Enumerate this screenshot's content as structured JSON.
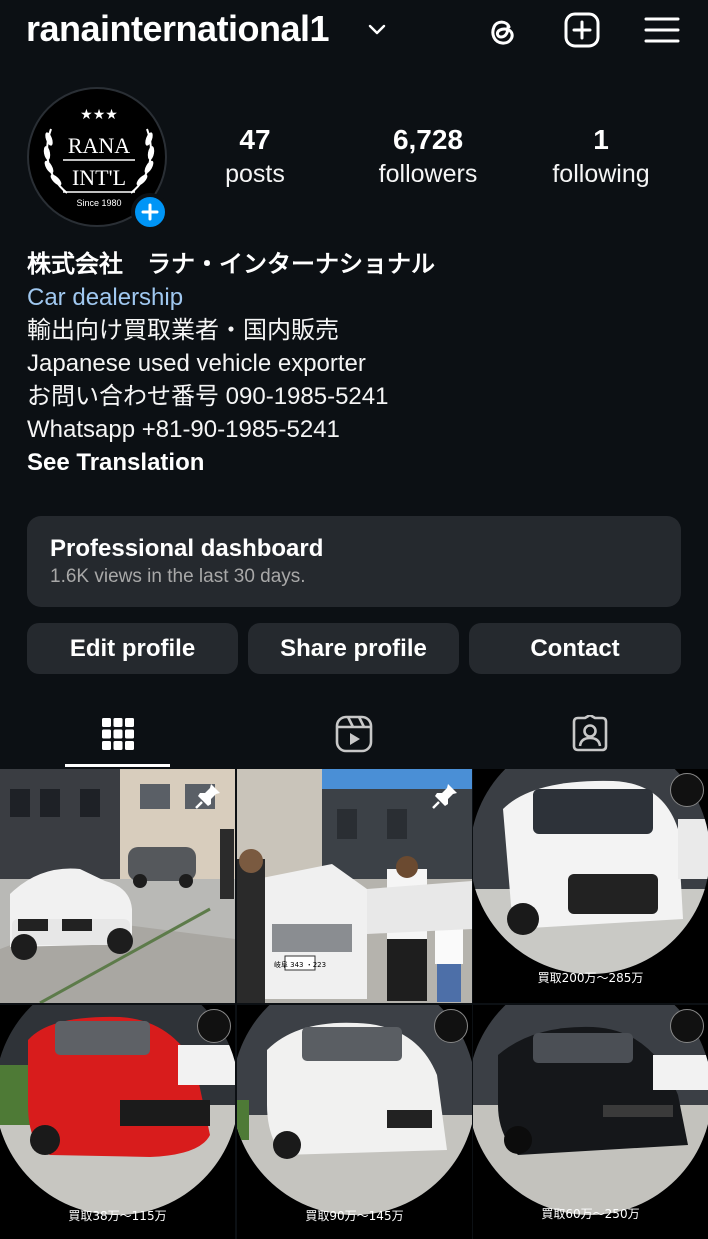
{
  "header": {
    "username": "ranainternational1",
    "icons": [
      "threads-icon",
      "create-post-icon",
      "menu-icon"
    ]
  },
  "avatar": {
    "logo_line1": "RANA",
    "logo_line2": "INT'L",
    "logo_since": "Since 1980"
  },
  "stats": {
    "posts_count": "47",
    "posts_label": "posts",
    "followers_count": "6,728",
    "followers_label": "followers",
    "following_count": "1",
    "following_label": "following"
  },
  "bio": {
    "name": "株式会社　ラナ・インターナショナル",
    "category": "Car dealership",
    "line1": "輸出向け買取業者・国内販売",
    "line2": "Japanese used vehicle exporter",
    "line3": "お問い合わせ番号 090-1985-5241",
    "line4": "Whatsapp +81-90-1985-5241",
    "see_translation": "See Translation"
  },
  "dashboard": {
    "title": "Professional dashboard",
    "subtitle": "1.6K views in the last 30 days."
  },
  "buttons": {
    "edit": "Edit profile",
    "share": "Share profile",
    "contact": "Contact"
  },
  "tabs": [
    "posts-grid-icon",
    "reels-icon",
    "tagged-icon"
  ],
  "grid": {
    "posts": [
      {
        "price": "",
        "pinned": true
      },
      {
        "price": "",
        "pinned": true,
        "plate": "岐阜 343 ・223"
      },
      {
        "price": "買取200万～285万",
        "pinned": false
      },
      {
        "price": "買取38万～115万",
        "pinned": false
      },
      {
        "price": "買取90万～145万",
        "pinned": false
      },
      {
        "price": "買取60万～250万",
        "pinned": false
      }
    ]
  },
  "colors": {
    "background": "#0c1014",
    "card": "#25292e",
    "accent": "#0095f6",
    "link": "#a0c8f0"
  }
}
